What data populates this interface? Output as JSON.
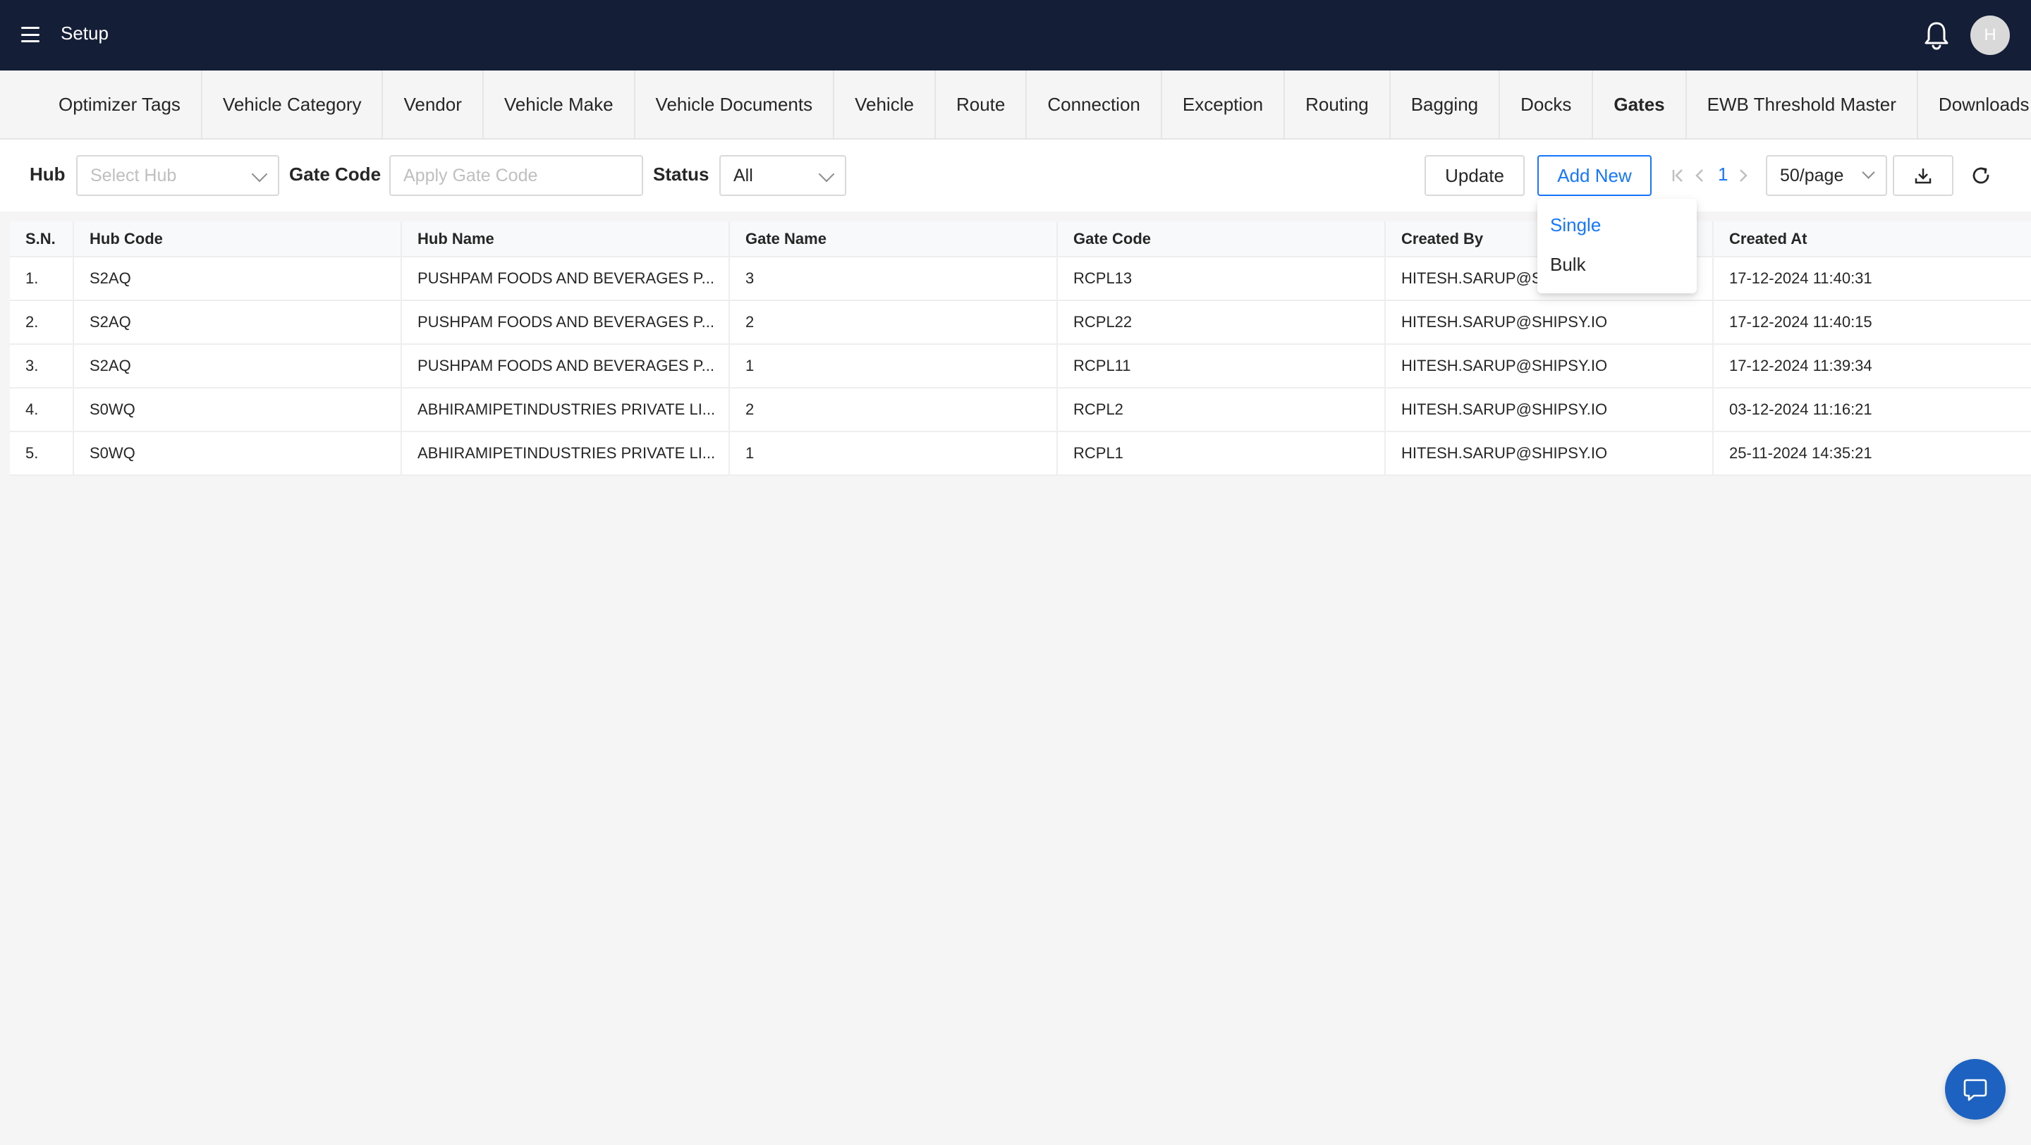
{
  "header": {
    "title": "Setup",
    "avatar_initial": "H"
  },
  "tabs": [
    {
      "label": "Optimizer Tags"
    },
    {
      "label": "Vehicle Category"
    },
    {
      "label": "Vendor"
    },
    {
      "label": "Vehicle Make"
    },
    {
      "label": "Vehicle Documents"
    },
    {
      "label": "Vehicle"
    },
    {
      "label": "Route"
    },
    {
      "label": "Connection"
    },
    {
      "label": "Exception"
    },
    {
      "label": "Routing"
    },
    {
      "label": "Bagging"
    },
    {
      "label": "Docks"
    },
    {
      "label": "Gates"
    },
    {
      "label": "EWB Threshold Master"
    },
    {
      "label": "Downloads"
    }
  ],
  "active_tab": "Gates",
  "filters": {
    "hub_label": "Hub",
    "hub_placeholder": "Select Hub",
    "gate_code_label": "Gate Code",
    "gate_code_placeholder": "Apply Gate Code",
    "status_label": "Status",
    "status_value": "All"
  },
  "actions": {
    "update_label": "Update",
    "add_new_label": "Add New"
  },
  "add_new_menu": {
    "items": [
      "Single",
      "Bulk"
    ]
  },
  "pagination": {
    "current_page": "1",
    "page_size": "50/page"
  },
  "table": {
    "columns": [
      "S.N.",
      "Hub Code",
      "Hub Name",
      "Gate Name",
      "Gate Code",
      "Created By",
      "Created At"
    ],
    "rows": [
      [
        "1.",
        "S2AQ",
        "PUSHPAM FOODS AND BEVERAGES P...",
        "3",
        "RCPL13",
        "HITESH.SARUP@SHIPSY.IO",
        "17-12-2024 11:40:31"
      ],
      [
        "2.",
        "S2AQ",
        "PUSHPAM FOODS AND BEVERAGES P...",
        "2",
        "RCPL22",
        "HITESH.SARUP@SHIPSY.IO",
        "17-12-2024 11:40:15"
      ],
      [
        "3.",
        "S2AQ",
        "PUSHPAM FOODS AND BEVERAGES P...",
        "1",
        "RCPL11",
        "HITESH.SARUP@SHIPSY.IO",
        "17-12-2024 11:39:34"
      ],
      [
        "4.",
        "S0WQ",
        "ABHIRAMIPETINDUSTRIES PRIVATE LI...",
        "2",
        "RCPL2",
        "HITESH.SARUP@SHIPSY.IO",
        "03-12-2024 11:16:21"
      ],
      [
        "5.",
        "S0WQ",
        "ABHIRAMIPETINDUSTRIES PRIVATE LI...",
        "1",
        "RCPL1",
        "HITESH.SARUP@SHIPSY.IO",
        "25-11-2024 14:35:21"
      ]
    ]
  },
  "colors": {
    "topbar": "#141e36",
    "accent": "#1677ff",
    "chat_button": "#1e62c1"
  },
  "icons": [
    "hamburger-icon",
    "bell-icon",
    "chevron-down-icon",
    "first-page-icon",
    "prev-page-icon",
    "next-page-icon",
    "download-icon",
    "refresh-icon",
    "chat-icon"
  ]
}
